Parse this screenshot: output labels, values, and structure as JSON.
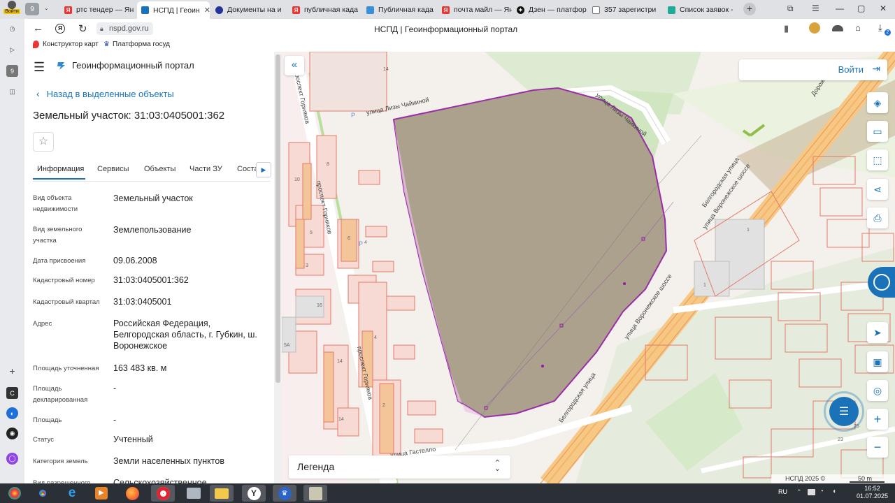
{
  "browser": {
    "profile_label": "Войти",
    "tab_counter": "9",
    "tabs": [
      {
        "label": "ртс тендер — Ян",
        "color": "#e33"
      },
      {
        "label": "НСПД | Геоин",
        "color": "#1a73b8"
      },
      {
        "label": "Документы на и",
        "color": "#223399"
      },
      {
        "label": "публичная када",
        "color": "#e33"
      },
      {
        "label": "Публичная када",
        "color": "#3a8fd8"
      },
      {
        "label": "почта майл — Ян",
        "color": "#e33"
      },
      {
        "label": "Дзен — платфор",
        "color": "#111"
      },
      {
        "label": "357 зарегистри",
        "color": "#777"
      },
      {
        "label": "Список заявок -",
        "color": "#2a9"
      }
    ],
    "new_tab": "+",
    "url": "nspd.gov.ru",
    "page_title": "НСПД | Геоинформационный портал",
    "bookmarks": [
      "Конструктор карт",
      "Платформа госуд"
    ],
    "ext_badge": "2"
  },
  "panel": {
    "portal_title": "Геоинформационный портал",
    "back_link": "Назад в выделенные объекты",
    "object_title": "Земельный участок: 31:03:0405001:362",
    "tabs": [
      "Информация",
      "Сервисы",
      "Объекты",
      "Части ЗУ",
      "Соста"
    ],
    "fields": [
      {
        "label": "Вид объекта недвижимости",
        "value": "Земельный участок"
      },
      {
        "label": "Вид земельного участка",
        "value": "Землепользование"
      },
      {
        "label": "Дата присвоения",
        "value": "09.06.2008"
      },
      {
        "label": "Кадастровый номер",
        "value": "31:03:0405001:362"
      },
      {
        "label": "Кадастровый квартал",
        "value": "31:03:0405001"
      },
      {
        "label": "Адрес",
        "value": "Российская Федерация, Белгородская область, г. Губкин, ш. Воронежское"
      },
      {
        "label": "Площадь уточненная",
        "value": "163 483 кв. м"
      },
      {
        "label": "Площадь декларированная",
        "value": "-"
      },
      {
        "label": "Площадь",
        "value": "-"
      },
      {
        "label": "Статус",
        "value": "Учтенный"
      },
      {
        "label": "Категория земель",
        "value": "Земли населенных пунктов"
      },
      {
        "label": "Вид разрешенного",
        "value": "Сельскохозяйственное"
      }
    ]
  },
  "map": {
    "login": "Войти",
    "legend": "Легенда",
    "copyright": "НСПД 2025 ©",
    "scale": "50 m",
    "streets": [
      "улица Лизы Чайкиной",
      "улица Лизы Чайкиной",
      "проспект Горняков",
      "проспект Горняков",
      "проспект Горняков",
      "Белгородская улица",
      "улица Воронежское шоссе",
      "улица Воронежское шоссе",
      "Белгородская улица",
      "улица Гастелло",
      "Дорожная"
    ],
    "house_numbers": [
      "14",
      "10",
      "8",
      "6",
      "5",
      "4",
      "3",
      "16",
      "5А",
      "14",
      "2",
      "4",
      "1",
      "1",
      "14",
      "25",
      "23"
    ],
    "parking": [
      "P",
      "P"
    ]
  },
  "taskbar": {
    "lang": "RU",
    "time": "16:52",
    "date": "01.07.2025"
  }
}
